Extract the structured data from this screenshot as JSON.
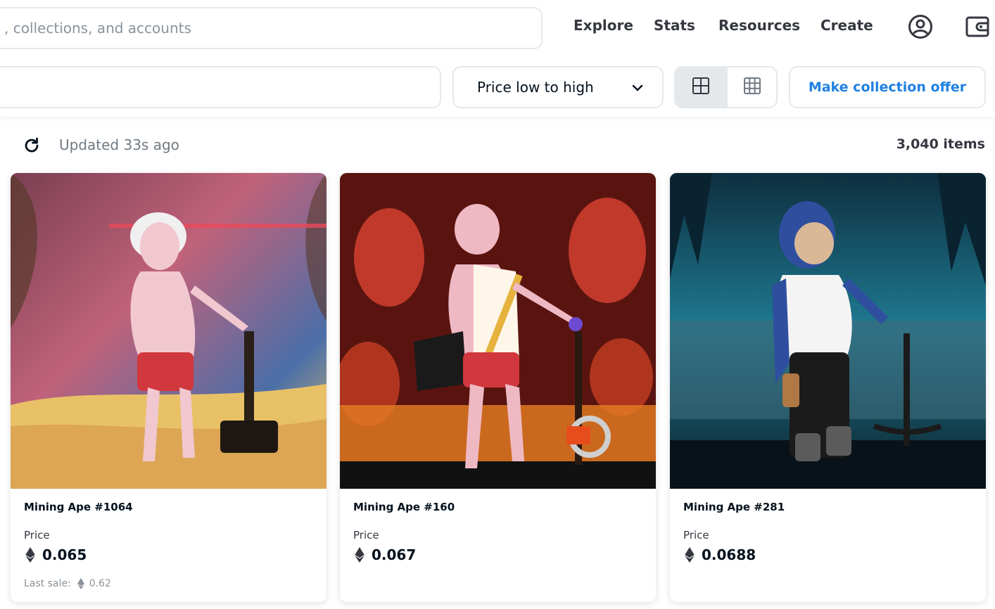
{
  "header": {
    "search_placeholder": ", collections, and accounts",
    "nav": [
      "Explore",
      "Stats",
      "Resources",
      "Create"
    ],
    "icons": [
      "account-icon",
      "wallet-icon"
    ]
  },
  "toolbar": {
    "filter_placeholder": "",
    "sort_label": "Price low to high",
    "view_options": [
      "large-grid-icon",
      "small-grid-icon"
    ],
    "active_view": "large-grid-icon",
    "offer_label": "Make collection offer"
  },
  "status": {
    "updated": "Updated 33s ago",
    "count": "3,040 items"
  },
  "items": [
    {
      "name": "Mining Ape #1064",
      "price_label": "Price",
      "price": "0.065",
      "last_sale_label": "Last sale:",
      "last_sale": "0.62"
    },
    {
      "name": "Mining Ape #160",
      "price_label": "Price",
      "price": "0.067"
    },
    {
      "name": "Mining Ape #281",
      "price_label": "Price",
      "price": "0.0688"
    }
  ],
  "colors": {
    "accent": "#2081e2",
    "border": "#e5e8eb",
    "text": "#04111d",
    "muted": "#707a83"
  }
}
